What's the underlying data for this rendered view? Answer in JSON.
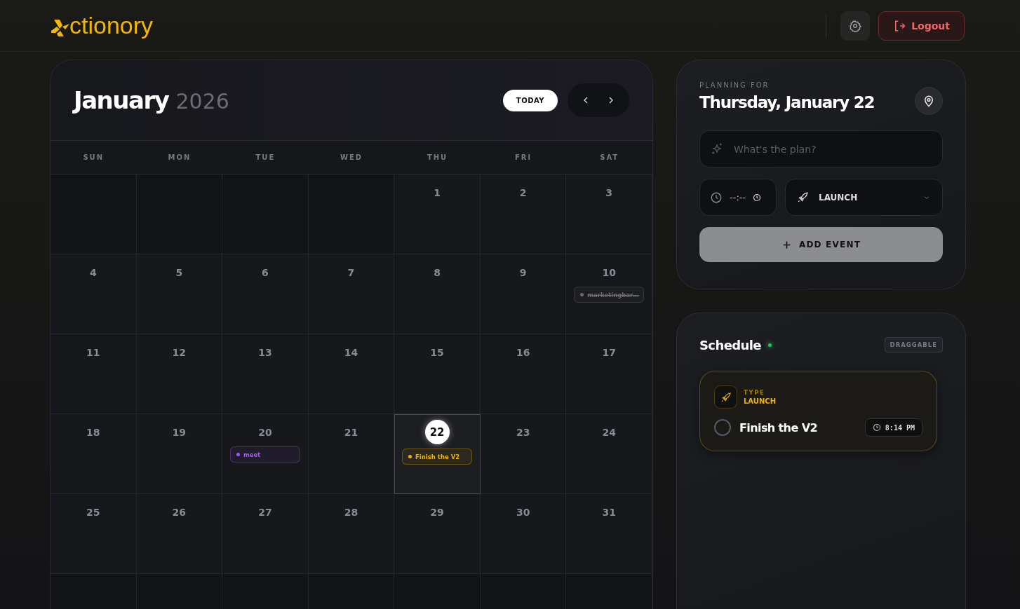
{
  "header": {
    "logo": "ctionory",
    "logout": "Logout"
  },
  "calendar": {
    "month": "January",
    "year": "2026",
    "today_button": "TODAY",
    "weekdays": [
      "SUN",
      "MON",
      "TUE",
      "WED",
      "THU",
      "FRI",
      "SAT"
    ],
    "weeks": [
      [
        {
          "kind": "empty"
        },
        {
          "kind": "empty"
        },
        {
          "kind": "empty"
        },
        {
          "kind": "empty"
        },
        {
          "kind": "day",
          "day": "1",
          "selected": false
        },
        {
          "kind": "day",
          "day": "2",
          "selected": false
        },
        {
          "kind": "day",
          "day": "3",
          "selected": false
        }
      ],
      [
        {
          "kind": "day",
          "day": "4",
          "selected": false
        },
        {
          "kind": "day",
          "day": "5",
          "selected": false
        },
        {
          "kind": "day",
          "day": "6",
          "selected": false
        },
        {
          "kind": "day",
          "day": "7",
          "selected": false
        },
        {
          "kind": "day",
          "day": "8",
          "selected": false
        },
        {
          "kind": "day",
          "day": "9",
          "selected": false
        },
        {
          "kind": "day",
          "day": "10",
          "selected": false,
          "events": [
            {
              "text": "marketingbar…",
              "color": "#6b6b70",
              "done": true
            }
          ]
        }
      ],
      [
        {
          "kind": "day",
          "day": "11",
          "selected": false
        },
        {
          "kind": "day",
          "day": "12",
          "selected": false
        },
        {
          "kind": "day",
          "day": "13",
          "selected": false
        },
        {
          "kind": "day",
          "day": "14",
          "selected": false
        },
        {
          "kind": "day",
          "day": "15",
          "selected": false
        },
        {
          "kind": "day",
          "day": "16",
          "selected": false
        },
        {
          "kind": "day",
          "day": "17",
          "selected": false
        }
      ],
      [
        {
          "kind": "day",
          "day": "18",
          "selected": false
        },
        {
          "kind": "day",
          "day": "19",
          "selected": false
        },
        {
          "kind": "day",
          "day": "20",
          "selected": false,
          "events": [
            {
              "text": "meet",
              "color": "#a855f7",
              "done": false
            }
          ]
        },
        {
          "kind": "day",
          "day": "21",
          "selected": false
        },
        {
          "kind": "day",
          "day": "22",
          "selected": true,
          "events": [
            {
              "text": "Finish the V2",
              "color": "#eab308",
              "done": false
            }
          ]
        },
        {
          "kind": "day",
          "day": "23",
          "selected": false
        },
        {
          "kind": "day",
          "day": "24",
          "selected": false
        }
      ],
      [
        {
          "kind": "day",
          "day": "25",
          "selected": false
        },
        {
          "kind": "day",
          "day": "26",
          "selected": false
        },
        {
          "kind": "day",
          "day": "27",
          "selected": false
        },
        {
          "kind": "day",
          "day": "28",
          "selected": false
        },
        {
          "kind": "day",
          "day": "29",
          "selected": false
        },
        {
          "kind": "day",
          "day": "30",
          "selected": false
        },
        {
          "kind": "day",
          "day": "31",
          "selected": false
        }
      ],
      [
        {
          "kind": "empty"
        },
        {
          "kind": "empty"
        },
        {
          "kind": "empty"
        },
        {
          "kind": "empty"
        },
        {
          "kind": "empty"
        },
        {
          "kind": "empty"
        },
        {
          "kind": "empty"
        }
      ]
    ]
  },
  "planner": {
    "label": "PLANNING FOR",
    "date": "Thursday, January 22",
    "plan_placeholder": "What's the plan?",
    "time_placeholder": "--:--",
    "type": "LAUNCH",
    "add_button": "ADD EVENT"
  },
  "schedule": {
    "title": "Schedule",
    "badge": "DRAGGABLE",
    "items": [
      {
        "type_label": "TYPE",
        "type": "LAUNCH",
        "title": "Finish the V2",
        "time": "8:14 PM",
        "done": false,
        "color": "#eab308"
      }
    ]
  }
}
